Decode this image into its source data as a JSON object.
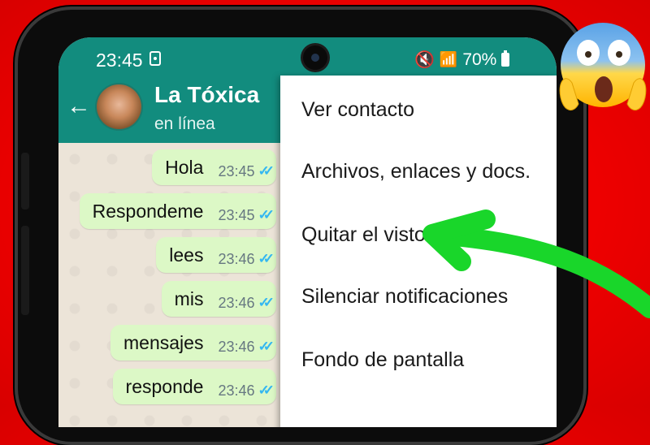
{
  "status_bar": {
    "time": "23:45",
    "battery": "70%"
  },
  "header": {
    "contact_name": "La Tóxica",
    "contact_status": "en línea"
  },
  "messages": [
    {
      "text": "Hola",
      "time": "23:45",
      "ticks": "✓✓"
    },
    {
      "text": "Respondeme",
      "time": "23:45",
      "ticks": "✓✓"
    },
    {
      "text": "lees",
      "time": "23:46",
      "ticks": "✓✓"
    },
    {
      "text": "mis",
      "time": "23:46",
      "ticks": "✓✓"
    },
    {
      "text": "mensajes",
      "time": "23:46",
      "ticks": "✓✓"
    },
    {
      "text": "responde",
      "time": "23:46",
      "ticks": "✓✓"
    }
  ],
  "menu": {
    "items": [
      "Ver contacto",
      "Archivos, enlaces y docs.",
      "Quitar el visto",
      "Silenciar notificaciones",
      "Fondo de pantalla"
    ]
  },
  "colors": {
    "header": "#128c7e",
    "bubble": "#dcf8c6",
    "ticks": "#34b7f1",
    "arrow": "#19d62a",
    "background": "#f00000"
  },
  "icons": [
    "back-arrow-icon",
    "mute-icon",
    "wifi-icon",
    "signal-icon",
    "battery-icon",
    "read-ticks-icon",
    "scared-emoji-icon"
  ]
}
